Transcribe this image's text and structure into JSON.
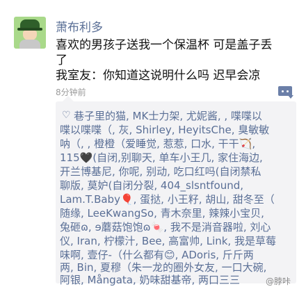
{
  "post": {
    "username": "萧布利多",
    "lines": [
      "喜欢的男孩子送我一个保温杯 可是盖子丢",
      "了",
      "我室友：你知道这说明什么吗 迟早会凉"
    ],
    "time": "8分钟前"
  },
  "likes": {
    "icon": "♡",
    "lines": [
      "巷子里的猫, MK士力架, 尤妮酱, , 喋喋以",
      "喋以喋喋（, 灰, Shirley, HeyitsChe, 臭敏敏",
      "呐（, , 橙橙（爱睡觉, 惹惹, 口水, 干干🏹,",
      "115🖤(自闭,别聊天, 单车小王几, 家住海边,",
      "开兰博基尼, 你呢, 别动, 吃口红吗(自闭禁私",
      "聊版, 莫妒(自闭分裂, 404_slsntfound,",
      "Lam.T.Baby🎈, 蛋挞, 小王籽, 胡山, 甜冬至（",
      "随缘, LeeKwangSo, 青木奈里, 辣辣小宝贝,",
      "兔砸ɷ, ɘ蘑菇饱饱ɷ🍬, 我不是消音器啦, 刘心",
      "仪, Iran, 柠檬汁, Bee, 高富帅, Link, 我是草莓",
      "味啊, 壹仔-（什么都有😊, ADoris, 斤斤两",
      "两, Bin, 夏穆（朱一龙的圈外女友, 一口大碗,",
      "阿银, Mångata, 奶味甜基帝, 两口三三"
    ]
  },
  "watermark": "@脖咔"
}
